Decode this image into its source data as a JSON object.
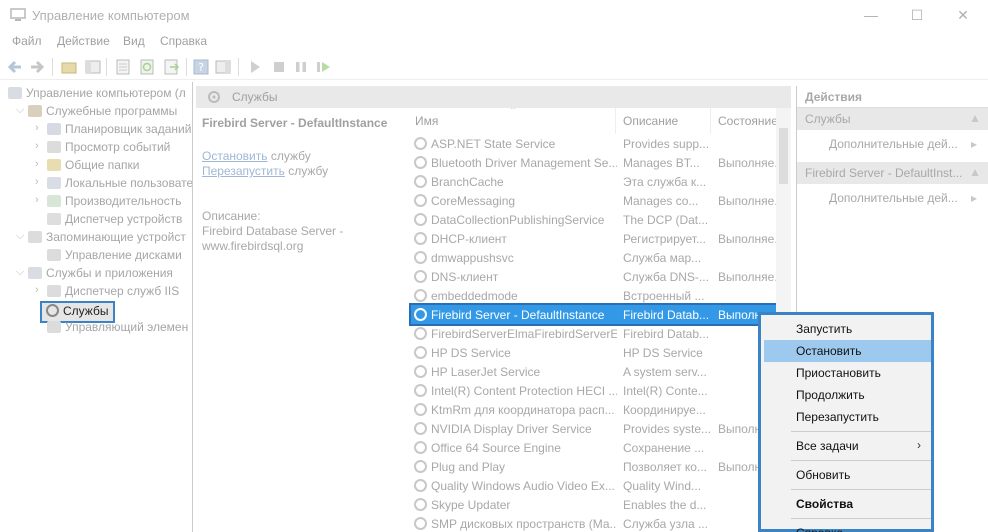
{
  "window": {
    "title": "Управление компьютером",
    "minimize": "—",
    "maximize": "☐",
    "close": "✕"
  },
  "menu": [
    "Файл",
    "Действие",
    "Вид",
    "Справка"
  ],
  "tree": {
    "root": "Управление компьютером (л",
    "system_tools": "Служебные программы",
    "task_scheduler": "Планировщик заданий",
    "event_viewer": "Просмотр событий",
    "shared_folders": "Общие папки",
    "local_users": "Локальные пользовате",
    "performance": "Производительность",
    "device_manager": "Диспетчер устройств",
    "storage": "Запоминающие устройст",
    "disk_management": "Управление дисками",
    "services_apps": "Службы и приложения",
    "iis_manager": "Диспетчер служб IIS",
    "services": "Службы",
    "wmi_control": "Управляющий элемен"
  },
  "center_header": "Службы",
  "description": {
    "service_name": "Firebird Server - DefaultInstance",
    "stop_link": "Остановить",
    "stop_suffix": " службу",
    "restart_link": "Перезапустить",
    "restart_suffix": " службу",
    "desc_label": "Описание:",
    "desc_text_1": "Firebird Database Server -",
    "desc_text_2": "www.firebirdsql.org"
  },
  "columns": {
    "name": "Имя",
    "description": "Описание",
    "status": "Состояние"
  },
  "services": [
    {
      "name": "ASP.NET State Service",
      "desc": "Provides supp...",
      "status": ""
    },
    {
      "name": "Bluetooth Driver Management Se...",
      "desc": "Manages BT...",
      "status": "Выполняе..."
    },
    {
      "name": "BranchCache",
      "desc": "Эта служба к...",
      "status": ""
    },
    {
      "name": "CoreMessaging",
      "desc": "Manages co...",
      "status": "Выполняе..."
    },
    {
      "name": "DataCollectionPublishingService",
      "desc": "The DCP (Dat...",
      "status": ""
    },
    {
      "name": "DHCP-клиент",
      "desc": "Регистрирует...",
      "status": "Выполняе..."
    },
    {
      "name": "dmwappushsvc",
      "desc": "Служба мар...",
      "status": ""
    },
    {
      "name": "DNS-клиент",
      "desc": "Служба DNS-...",
      "status": "Выполняе..."
    },
    {
      "name": "embeddedmode",
      "desc": "Встроенный ...",
      "status": ""
    },
    {
      "name": "Firebird Server - DefaultInstance",
      "desc": "Firebird Datab...",
      "status": "Выполне..."
    },
    {
      "name": "FirebirdServerElmaFirebirdServerExp...",
      "desc": "Firebird Datab...",
      "status": ""
    },
    {
      "name": "HP DS Service",
      "desc": "HP DS Service",
      "status": ""
    },
    {
      "name": "HP LaserJet Service",
      "desc": "A system serv...",
      "status": ""
    },
    {
      "name": "Intel(R) Content Protection HECI ...",
      "desc": "Intel(R) Conte...",
      "status": ""
    },
    {
      "name": "KtmRm для координатора расп...",
      "desc": "Координируе...",
      "status": ""
    },
    {
      "name": "NVIDIA Display Driver Service",
      "desc": "Provides syste...",
      "status": "Выполняе..."
    },
    {
      "name": "Office 64 Source Engine",
      "desc": "Сохранение ...",
      "status": ""
    },
    {
      "name": "Plug and Play",
      "desc": "Позволяет ко...",
      "status": "Выполняе..."
    },
    {
      "name": "Quality Windows Audio Video Ex...",
      "desc": "Quality Wind...",
      "status": ""
    },
    {
      "name": "Skype Updater",
      "desc": "Enables the d...",
      "status": ""
    },
    {
      "name": "SMP дисковых пространств (Ма...",
      "desc": "Служба узла ...",
      "status": ""
    }
  ],
  "actions": {
    "header": "Действия",
    "group1": "Службы",
    "more1": "Дополнительные дей...",
    "group2": "Firebird Server - DefaultInst...",
    "more2": "Дополнительные дей..."
  },
  "context_menu": {
    "start": "Запустить",
    "stop": "Остановить",
    "pause": "Приостановить",
    "resume": "Продолжить",
    "restart": "Перезапустить",
    "all_tasks": "Все задачи",
    "refresh": "Обновить",
    "properties": "Свойства",
    "help": "Справка"
  },
  "colors": {
    "selection": "#3399e6",
    "context_highlight": "#9ec9ef",
    "focus_border": "#3a83c4"
  }
}
